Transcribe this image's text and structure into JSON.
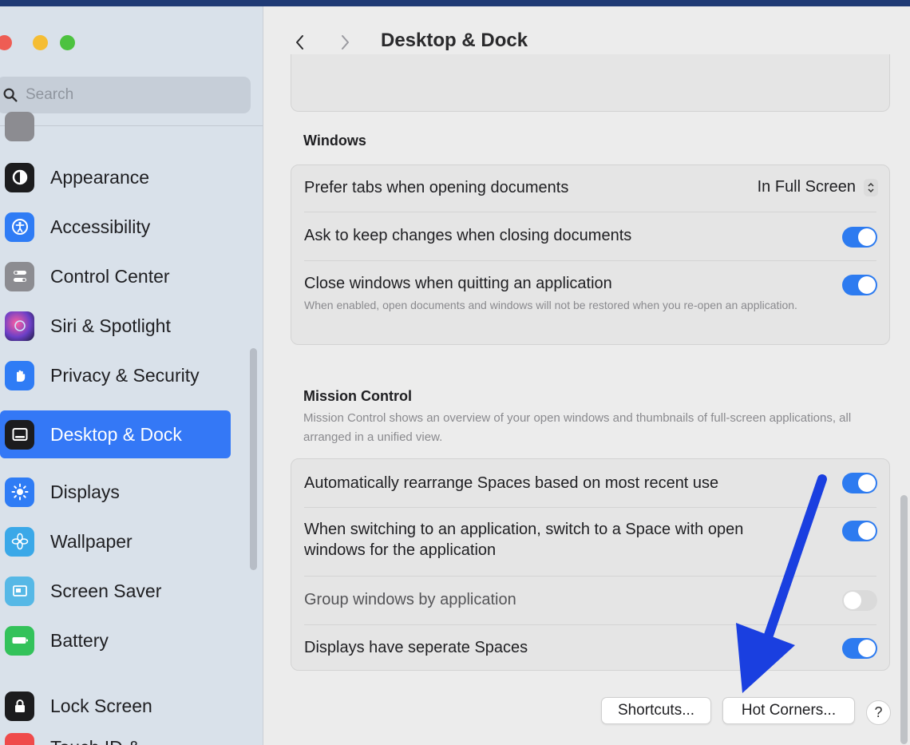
{
  "window": {
    "title": "Desktop & Dock",
    "search": {
      "placeholder": "Search"
    }
  },
  "sidebar": {
    "items": [
      {
        "label": "Appearance",
        "icon": "appearance-icon",
        "color": "#1c1c1e"
      },
      {
        "label": "Accessibility",
        "icon": "accessibility-icon",
        "color": "#2f7cf5"
      },
      {
        "label": "Control Center",
        "icon": "control-center-icon",
        "color": "#8c8c91"
      },
      {
        "label": "Siri & Spotlight",
        "icon": "siri-icon",
        "color": "#6b3fc7"
      },
      {
        "label": "Privacy & Security",
        "icon": "hand-icon",
        "color": "#2f7cf5"
      },
      {
        "label": "Desktop & Dock",
        "icon": "dock-icon",
        "color": "#1c1c1e",
        "selected": true
      },
      {
        "label": "Displays",
        "icon": "sun-icon",
        "color": "#2f7cf5"
      },
      {
        "label": "Wallpaper",
        "icon": "flower-icon",
        "color": "#3aa8e8"
      },
      {
        "label": "Screen Saver",
        "icon": "screen-saver-icon",
        "color": "#56b8e6"
      },
      {
        "label": "Battery",
        "icon": "battery-icon",
        "color": "#33c25a"
      },
      {
        "label": "Lock Screen",
        "icon": "lock-icon",
        "color": "#1c1c1e"
      },
      {
        "label": "Touch ID &",
        "icon": "fingerprint-icon",
        "color": "#ef4a4a"
      }
    ]
  },
  "windows_section": {
    "title": "Windows",
    "rows": [
      {
        "label": "Prefer tabs when opening documents",
        "value": "In Full Screen"
      },
      {
        "label": "Ask to keep changes when closing documents",
        "toggle": true
      },
      {
        "label": "Close windows when quitting an application",
        "toggle": true,
        "description": "When enabled, open documents and windows will not be restored when you re-open an application."
      }
    ]
  },
  "mission_control": {
    "title": "Mission Control",
    "description": "Mission Control shows an overview of your open windows and thumbnails of full-screen applications, all arranged in a unified view.",
    "rows": [
      {
        "label": "Automatically rearrange Spaces based on most recent use",
        "toggle": true
      },
      {
        "label_line1": "When switching to an application, switch to a Space with open",
        "label_line2": "windows for the application",
        "toggle": true
      },
      {
        "label": "Group windows by application",
        "toggle": false
      },
      {
        "label": "Displays have seperate Spaces",
        "toggle": true
      }
    ]
  },
  "footer": {
    "shortcuts": "Shortcuts...",
    "hot_corners": "Hot Corners...",
    "help": "?"
  },
  "colors": {
    "accent": "#3478f6",
    "annotation_arrow": "#1a3fe0"
  }
}
